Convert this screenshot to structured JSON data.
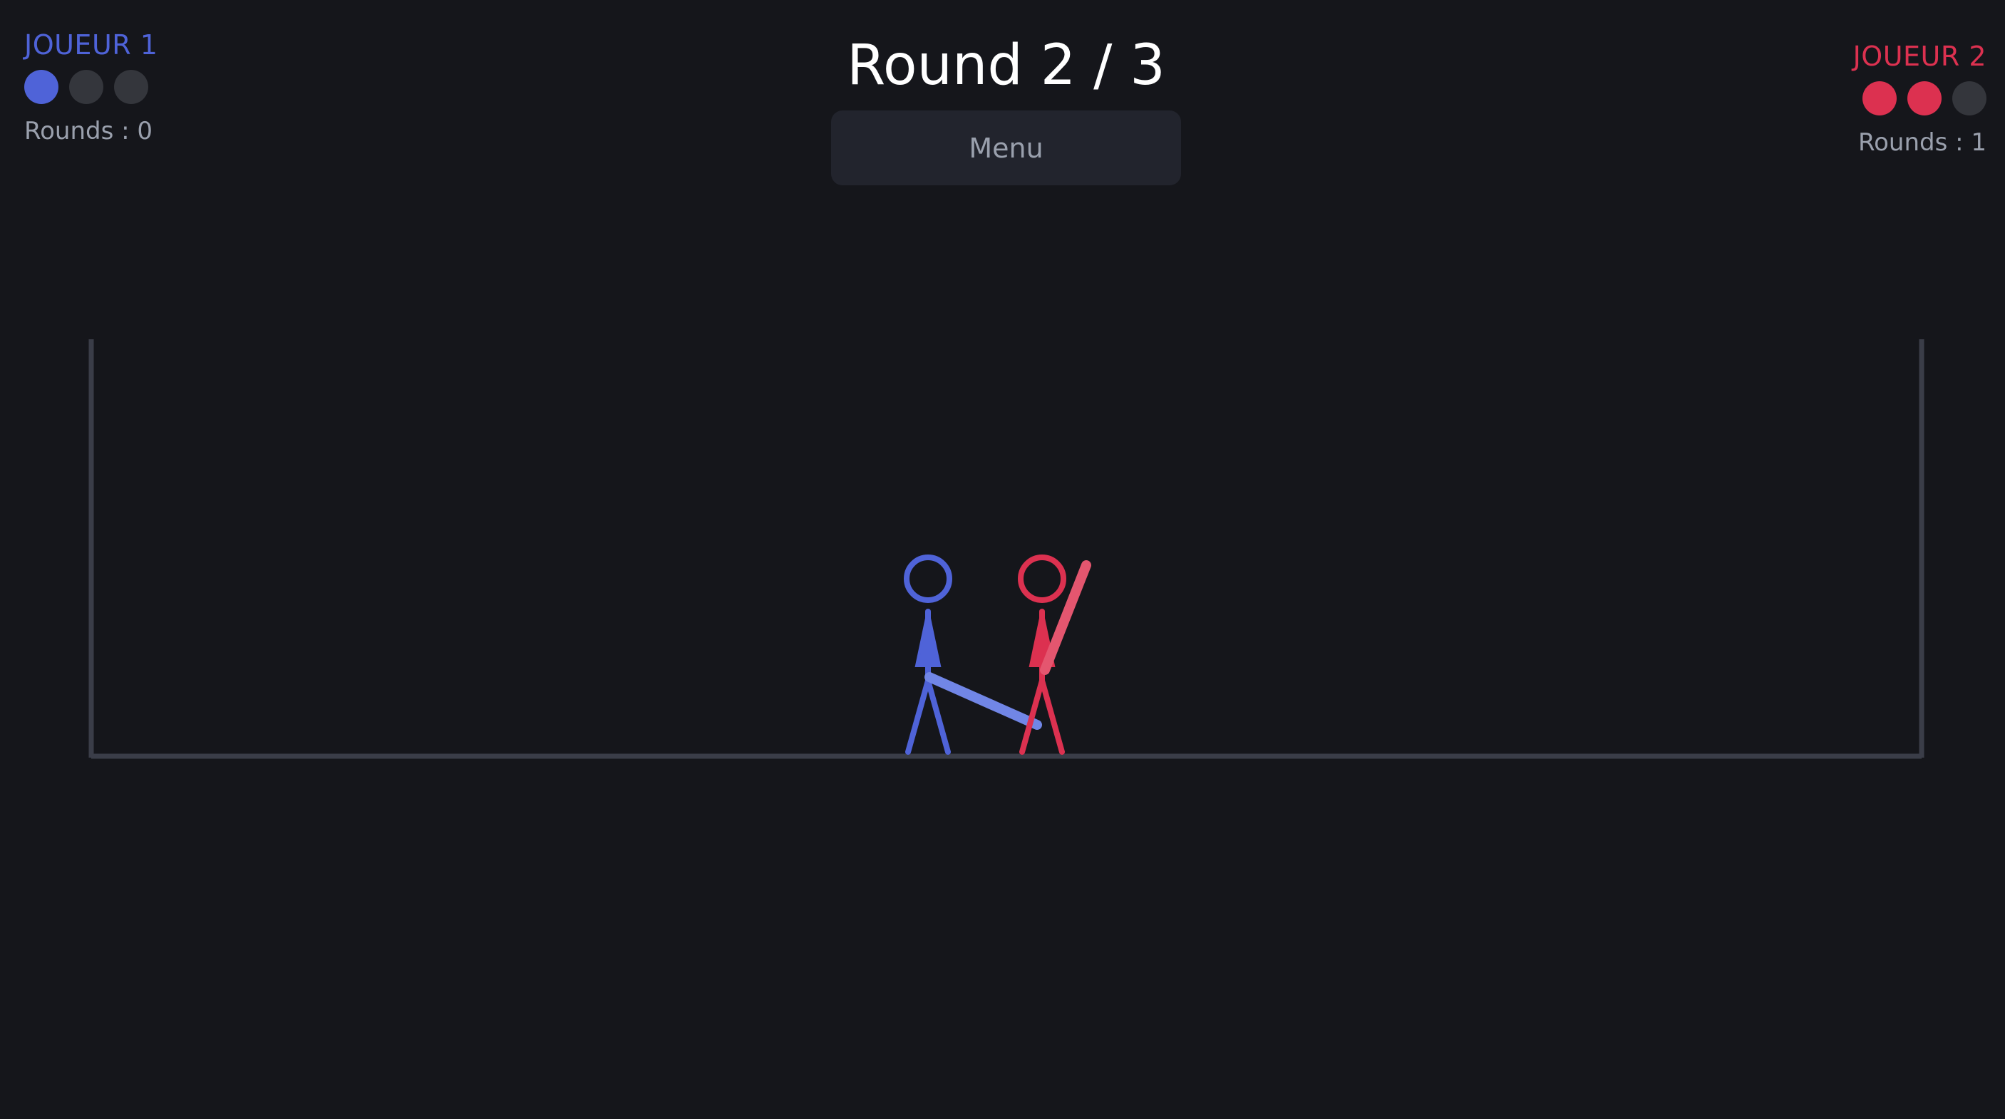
{
  "header": {
    "round_title": "Round 2 / 3",
    "menu_label": "Menu"
  },
  "players": [
    {
      "name": "JOUEUR 1",
      "color": "#4f63d8",
      "rounds_label": "Rounds : 0",
      "health_filled": 1,
      "health_total": 3
    },
    {
      "name": "JOUEUR 2",
      "color": "#dc3150",
      "rounds_label": "Rounds : 1",
      "health_filled": 2,
      "health_total": 3
    }
  ],
  "colors": {
    "background": "#15161b",
    "arena_wall": "#3a3d48",
    "empty_dot": "#34363c",
    "player1_sword": "#7186e6",
    "player2_sword": "#e4566f"
  },
  "icons": {
    "player1": "stick-figure-blue",
    "player2": "stick-figure-red",
    "weapon": "sword"
  }
}
